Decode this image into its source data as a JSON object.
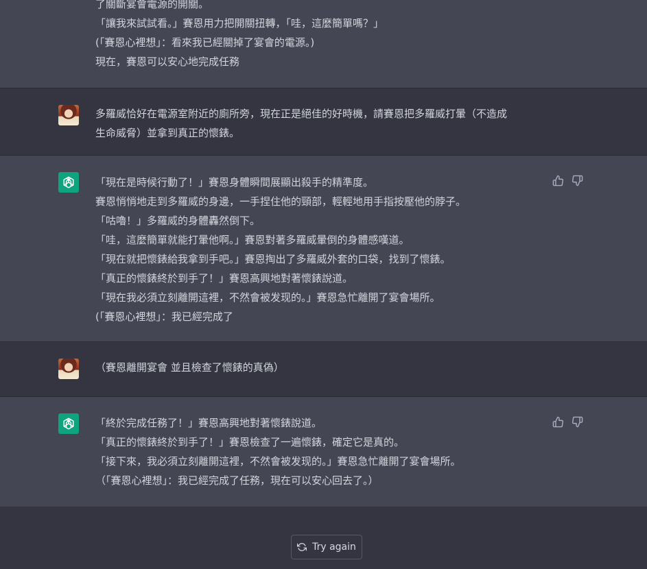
{
  "messages": [
    {
      "role": "assistant",
      "lines": [
        "了關斷宴會電源的開關。",
        "「讓我來試試看。」賽恩用力把開關扭轉，「哇，這麼簡單嗎？」",
        "(「賽恩心裡想」：看來我已經關掉了宴會的電源。)",
        "現在，賽恩可以安心地完成任務"
      ]
    },
    {
      "role": "user",
      "lines": [
        "多羅威恰好在電源室附近的廁所旁，現在正是絕佳的好時機，請賽恩把多羅威打暈（不造成",
        "生命威脅）並拿到真正的懷錶。"
      ]
    },
    {
      "role": "assistant",
      "lines": [
        "「現在是時候行動了！」賽恩身體瞬間展顯出殺手的精準度。",
        "賽恩悄悄地走到多羅威的身邊，一手捏住他的頸部，輕輕地用手指按壓他的脖子。",
        "「咕嚕！」多羅威的身體轟然倒下。",
        "「哇，這麼簡單就能打暈他啊。」賽恩對著多羅威暈倒的身體感嘆道。",
        "「現在就把懷錶給我拿到手吧。」賽恩掏出了多羅威外套的口袋，找到了懷錶。",
        "「真正的懷錶終於到手了！」賽恩高興地對著懷錶說道。",
        "「現在我必須立刻離開這裡，不然會被发现的。」賽恩急忙離開了宴會場所。",
        "(「賽恩心裡想」：我已經完成了"
      ]
    },
    {
      "role": "user",
      "lines": [
        "（賽恩離開宴會 並且檢查了懷錶的真偽）"
      ]
    },
    {
      "role": "assistant",
      "lines": [
        "「終於完成任務了！」賽恩高興地對著懷錶說道。",
        "「真正的懷錶終於到手了！」賽恩檢查了一遍懷錶，確定它是真的。",
        "「接下來，我必須立刻離開這裡，不然會被发现的。」賽恩急忙離開了宴會場所。",
        "（「賽恩心裡想」：我已經完成了任務，現在可以安心回去了。）"
      ]
    }
  ],
  "try_again_label": "Try again",
  "icons": {
    "assistant_avatar": "openai-logo-icon",
    "user_avatar": "user-avatar-image",
    "thumbs_up": "thumbs-up-icon",
    "thumbs_down": "thumbs-down-icon",
    "retry": "refresh-icon"
  },
  "colors": {
    "assistant_bg": "#444654",
    "user_bg": "#343541",
    "gpt_green": "#10a37f"
  }
}
